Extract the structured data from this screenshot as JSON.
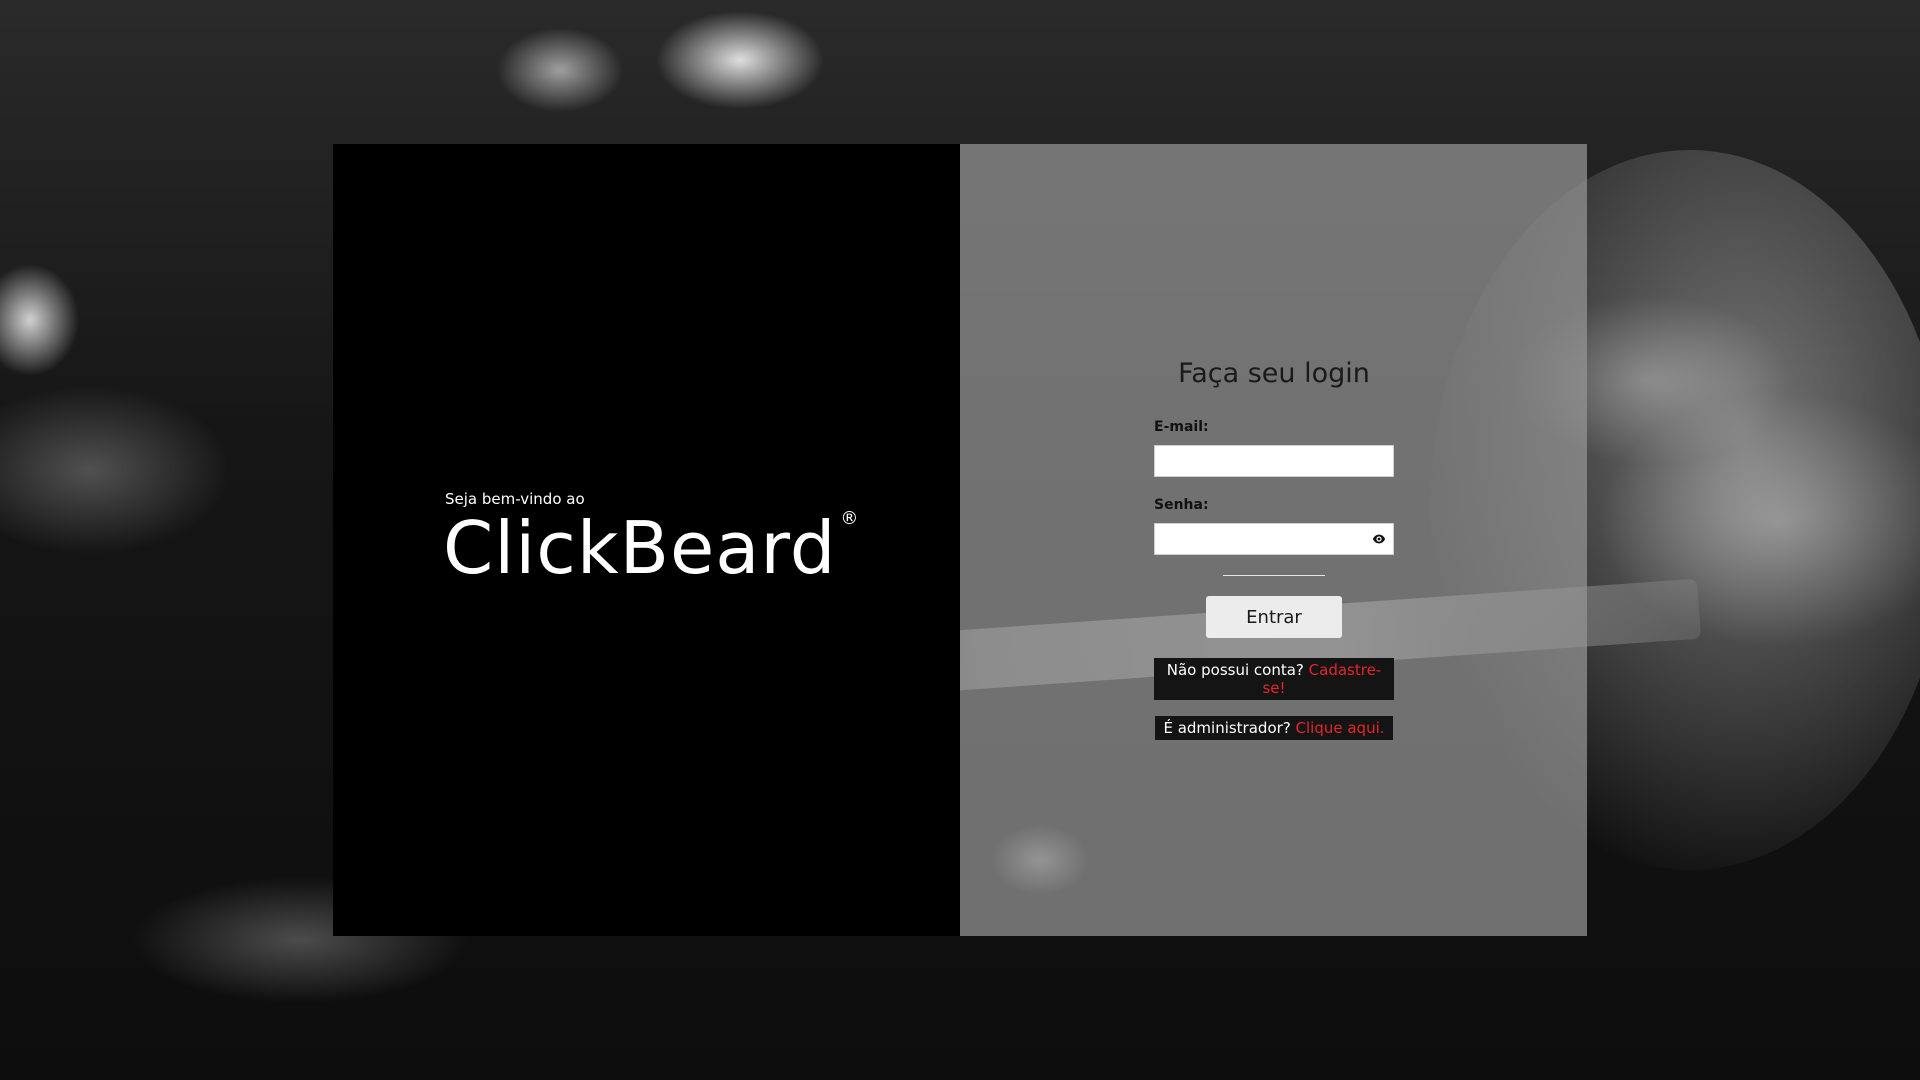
{
  "welcome": {
    "intro": "Seja bem-vindo ao",
    "brand": "ClickBeard",
    "brand_mark": "®"
  },
  "login": {
    "title": "Faça seu login",
    "email_label": "E-mail:",
    "email_value": "",
    "password_label": "Senha:",
    "password_value": "",
    "submit_label": "Entrar"
  },
  "links": {
    "signup_prefix": "Não possui conta?",
    "signup_link": "Cadastre-se!",
    "admin_prefix": "É administrador?",
    "admin_link": "Clique aqui."
  },
  "icons": {
    "password_toggle": "eye-icon"
  },
  "colors": {
    "left_panel": "#000000",
    "right_panel": "#969696",
    "link_red": "#e8242a",
    "link_box": "#141414"
  }
}
